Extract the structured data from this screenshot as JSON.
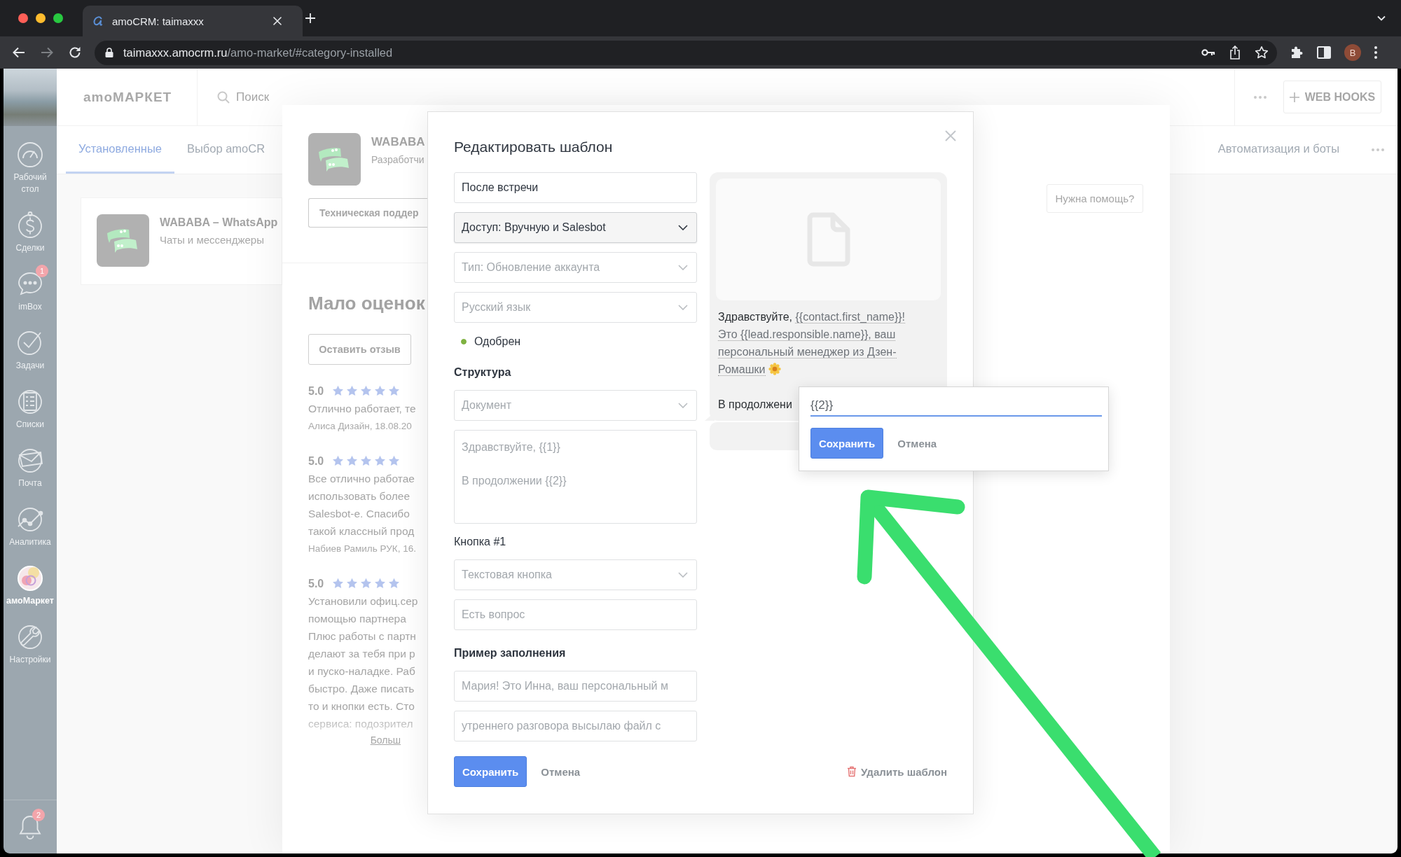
{
  "browser": {
    "tab_title": "amoCRM: taimaxxx",
    "url_host": "taimaxxx.amocrm.ru",
    "url_path": "/amo-market/#category-installed",
    "profile_initial": "B"
  },
  "sidebar": {
    "items": [
      {
        "kind": "dashboard",
        "label": "Рабочий стол",
        "selected": false
      },
      {
        "kind": "deals",
        "label": "Сделки",
        "selected": false
      },
      {
        "kind": "chats",
        "label": "imBox",
        "selected": false,
        "badge": "1"
      },
      {
        "kind": "tasks",
        "label": "Задачи",
        "selected": false
      },
      {
        "kind": "lists",
        "label": "Списки",
        "selected": false
      },
      {
        "kind": "mail",
        "label": "Почта",
        "selected": false
      },
      {
        "kind": "analytics",
        "label": "Аналитика",
        "selected": false
      },
      {
        "kind": "market",
        "label": "амоМаркет",
        "selected": true
      },
      {
        "kind": "settings",
        "label": "Настройки",
        "selected": false
      }
    ],
    "notifications_badge": "2"
  },
  "market": {
    "logo": "amoМАРКЕТ",
    "search_placeholder": "Поиск",
    "webhooks_button": "WEB HOOKS",
    "tabs": [
      {
        "label": "Установленные",
        "selected": true
      },
      {
        "label": "Выбор amoCR",
        "selected": false
      },
      {
        "label": "Автоматизация и боты",
        "selected": false
      }
    ],
    "cards": [
      {
        "title": "WABABA – WhatsApp",
        "category": "Чаты и мессенджеры"
      }
    ]
  },
  "app_panel": {
    "name": "WABABA",
    "developer": "Разработчи",
    "support_button": "Техническая поддер",
    "help_button": "Нужна помощь?",
    "rating_heading": "Мало оценок",
    "review_button": "Оставить отзыв",
    "reviews": [
      {
        "score": "5.0",
        "stars": 5,
        "text_lines": [
          "Отлично работает, те"
        ],
        "author": "Алиса Дизайн, 18.08.20"
      },
      {
        "score": "5.0",
        "stars": 5,
        "text_lines": [
          "Все отлично работае",
          "использовать более",
          "Salesbot-е. Спасибо",
          "такой классный прод"
        ],
        "author": "Набиев Рамиль РУК, 16."
      },
      {
        "score": "5.0",
        "stars": 5,
        "text_lines": [
          "Установили офиц.сер",
          "помощью партнера",
          "Плюс работы с партн",
          "делают за тебя при р",
          "и пуско-наладке. Раб",
          "быстро. Даже писать",
          "то и кнопки есть. Сто",
          "сервиса: подозрител"
        ]
      }
    ],
    "more_link": "Больш"
  },
  "editor": {
    "title": "Редактировать шаблон",
    "form": [
      {
        "kind": "input",
        "value": "После встречи",
        "disabled": false
      },
      {
        "kind": "select",
        "value": "Доступ: Вручную и Salesbot",
        "disabled": false
      },
      {
        "kind": "select",
        "value": "Тип: Обновление аккаунта",
        "disabled": true
      },
      {
        "kind": "select",
        "value": "Русский язык",
        "disabled": true
      },
      {
        "kind": "status",
        "label": "Одобрен",
        "color": "#7fb241"
      },
      {
        "kind": "heading",
        "text": "Структура"
      },
      {
        "kind": "select",
        "value": "Документ",
        "disabled": true
      },
      {
        "kind": "textarea",
        "value": "Здравствуйте, {{1}}\n\nВ продолжении {{2}}",
        "disabled": true
      },
      {
        "kind": "label",
        "text": "Кнопка #1"
      },
      {
        "kind": "select",
        "value": "Текстовая кнопка",
        "disabled": true
      },
      {
        "kind": "input",
        "value": "Есть вопрос",
        "disabled": true
      },
      {
        "kind": "heading",
        "text": "Пример заполнения"
      },
      {
        "kind": "input",
        "value": "Мария! Это Инна, ваш персональный м",
        "disabled": true
      },
      {
        "kind": "input",
        "value": "утреннего разговора высылаю файл с",
        "disabled": true
      }
    ],
    "preview": {
      "greeting": "Здравствуйте,",
      "sample": "{{contact.first_name}}! Это {{lead.responsible.name}}, ваш персональный менеджер из Дзен-Ромашки",
      "continuation": "В продолжени"
    },
    "variable_popup": {
      "value": "{{2}}",
      "save_button": "Сохранить",
      "cancel_button": "Отмена"
    },
    "save_button": "Сохранить",
    "cancel_button": "Отмена",
    "delete_button": "Удалить шаблон"
  }
}
